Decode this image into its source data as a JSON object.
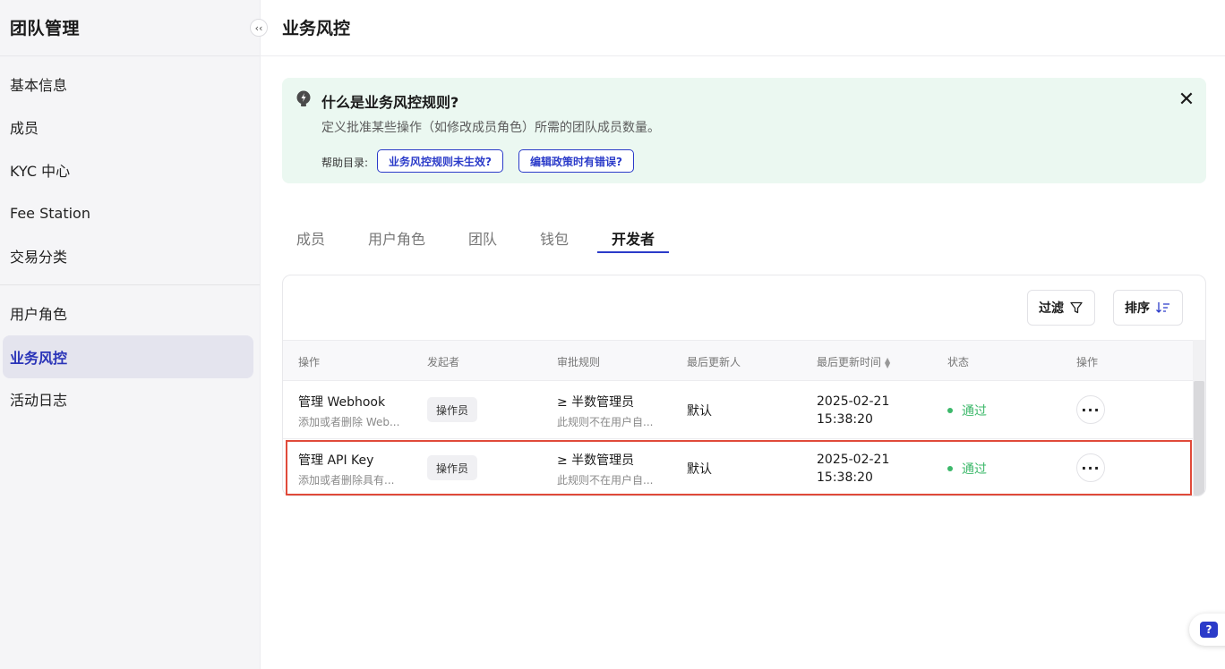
{
  "sidebar": {
    "title": "团队管理",
    "collapse_icon": "‹‹",
    "items": [
      {
        "label": "基本信息"
      },
      {
        "label": "成员"
      },
      {
        "label": "KYC 中心"
      },
      {
        "label": "Fee Station"
      },
      {
        "label": "交易分类"
      },
      {
        "label": "用户角色"
      },
      {
        "label": "业务风控",
        "active": true
      },
      {
        "label": "活动日志"
      }
    ]
  },
  "header": {
    "title": "业务风控"
  },
  "banner": {
    "icon": "lightbulb-icon",
    "title": "什么是业务风控规则?",
    "description": "定义批准某些操作（如修改成员角色）所需的团队成员数量。",
    "close_icon": "✕",
    "help_label": "帮助目录:",
    "links": [
      "业务风控规则未生效?",
      "编辑政策时有错误?"
    ]
  },
  "tabs": [
    {
      "label": "成员"
    },
    {
      "label": "用户角色"
    },
    {
      "label": "团队"
    },
    {
      "label": "钱包"
    },
    {
      "label": "开发者",
      "active": true
    }
  ],
  "toolbar": {
    "filter_label": "过滤",
    "filter_icon": "funnel-icon",
    "sort_label": "排序",
    "sort_icon": "sort-descending-icon"
  },
  "table": {
    "columns": [
      "操作",
      "发起者",
      "审批规则",
      "最后更新人",
      "最后更新时间",
      "状态",
      "操作"
    ],
    "rows": [
      {
        "action": "管理 Webhook",
        "action_desc": "添加或者删除 Web...",
        "initiator": "操作员",
        "rule": "≥ 半数管理员",
        "rule_desc": "此规则不在用户自...",
        "updated_by": "默认",
        "updated_date": "2025-02-21",
        "updated_time": "15:38:20",
        "status": "通过"
      },
      {
        "action": "管理 API Key",
        "action_desc": "添加或者删除具有...",
        "initiator": "操作员",
        "rule": "≥ 半数管理员",
        "rule_desc": "此规则不在用户自...",
        "updated_by": "默认",
        "updated_date": "2025-02-21",
        "updated_time": "15:38:20",
        "status": "通过"
      }
    ]
  },
  "colors": {
    "accent": "#2b3bc9",
    "success": "#3cb86a",
    "banner_bg": "#ebf8f1",
    "highlight": "#e04a3a"
  }
}
